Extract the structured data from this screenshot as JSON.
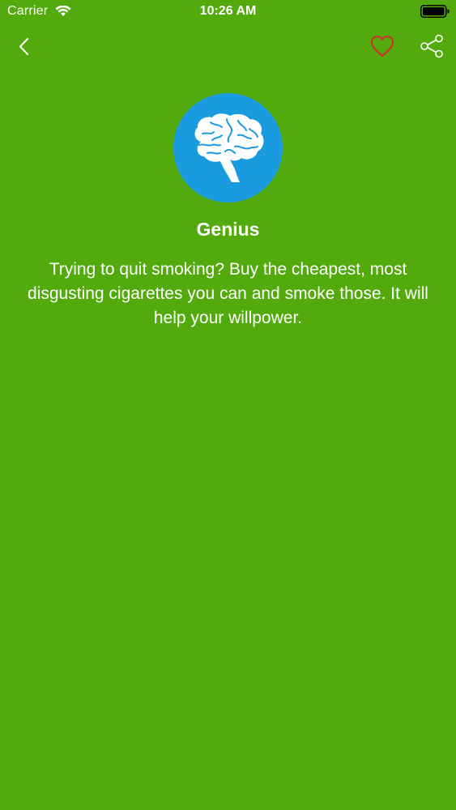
{
  "status_bar": {
    "carrier": "Carrier",
    "time": "10:26 AM",
    "icons": [
      "wifi-icon",
      "battery-icon"
    ]
  },
  "nav": {
    "back_icon": "chevron-left-icon",
    "favorite_icon": "heart-outline-icon",
    "share_icon": "share-icon"
  },
  "content": {
    "icon": "brain-icon",
    "title": "Genius",
    "quote": "Trying to quit smoking? Buy the cheapest, most disgusting cigarettes you can and smoke those. It will help your willpower."
  },
  "colors": {
    "background": "#52AA0D",
    "avatar_background": "#1A9ADF",
    "heart": "#D92B2B",
    "text": "#FFFFFF"
  }
}
